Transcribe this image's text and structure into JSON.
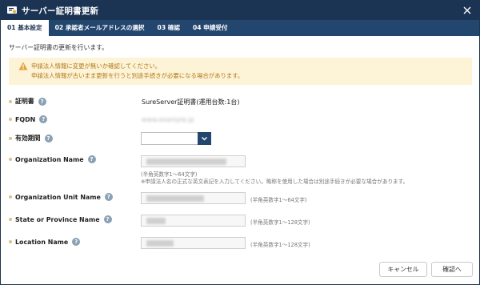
{
  "window": {
    "title": "サーバー証明書更新"
  },
  "tabs": [
    {
      "label": "01 基本設定",
      "active": true
    },
    {
      "label": "02 承認者メールアドレスの選択",
      "active": false
    },
    {
      "label": "03 確認",
      "active": false
    },
    {
      "label": "04 申請受付",
      "active": false
    }
  ],
  "intro": "サーバー証明書の更新を行います。",
  "warning": {
    "line1": "申請法人情報に変更が無いか確認してください。",
    "line2": "申請法人情報が古いまま更新を行うと別途手続きが必要になる場合があります。"
  },
  "fields": {
    "cert": {
      "label": "証明書",
      "value": "SureServer証明書(運用台数:1台)"
    },
    "fqdn": {
      "label": "FQDN",
      "value": "www.example.jp"
    },
    "period": {
      "label": "有効期間",
      "value": ""
    },
    "org": {
      "label": "Organization Name",
      "value": "Example Corporation Co., Ltd.",
      "hint1": "(半角英数字1～64文字)",
      "hint2": "※申請法人名の正式な英文表記を入力してください。略称を使用した場合は別途手続きが必要な場合があります。"
    },
    "unit": {
      "label": "Organization Unit Name",
      "value": "System Division",
      "hint": "(半角英数字1～64文字)"
    },
    "state": {
      "label": "State or Province Name",
      "value": "Tokyo",
      "hint": "(半角英数字1～128文字)"
    },
    "location": {
      "label": "Location Name",
      "value": "Shibuya-ku",
      "hint": "(半角英数字1～128文字)"
    }
  },
  "buttons": {
    "cancel": "キャンセル",
    "confirm": "確認へ"
  },
  "colors": {
    "titlebar": "#1b3453",
    "tabbar": "#23466e",
    "warning_bg": "#fdf3d6",
    "warning_text": "#b27a1b"
  }
}
